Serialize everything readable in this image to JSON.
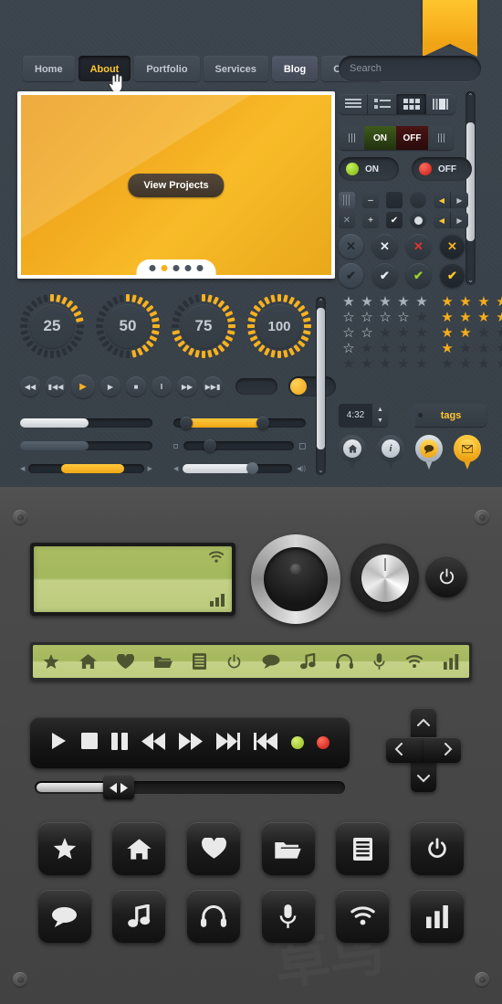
{
  "nav": {
    "items": [
      {
        "label": "Home",
        "state": "normal"
      },
      {
        "label": "About",
        "state": "active-dark"
      },
      {
        "label": "Portfolio",
        "state": "normal"
      },
      {
        "label": "Services",
        "state": "normal"
      },
      {
        "label": "Blog",
        "state": "active-blue"
      },
      {
        "label": "Contact",
        "state": "normal"
      }
    ]
  },
  "search": {
    "placeholder": "Search",
    "value": "",
    "icon": "search-icon"
  },
  "hero": {
    "button_label": "View Projects",
    "dots": 5,
    "active_dot": 2
  },
  "dials": [
    {
      "value": "25",
      "percent": 25
    },
    {
      "value": "50",
      "percent": 50
    },
    {
      "value": "75",
      "percent": 75
    },
    {
      "value": "100",
      "percent": 100
    }
  ],
  "transport_top": {
    "buttons": [
      "rewind-icon",
      "skip-back-icon",
      "play-icon",
      "play-alt-icon",
      "stop-icon",
      "pause-icon",
      "fast-forward-icon",
      "skip-forward-icon"
    ],
    "glyphs": [
      "◀◀",
      "▮◀◀",
      "▶",
      "▶",
      "■",
      "‖",
      "▶▶",
      "▶▶▮"
    ]
  },
  "sliders": {
    "left": [
      {
        "name": "white-slider",
        "fill": "white",
        "percent": 52
      },
      {
        "name": "steel-slider",
        "fill": "steel",
        "percent": 52
      },
      {
        "name": "gold-slider",
        "fill": "gold",
        "percent": 55
      }
    ],
    "right": [
      {
        "name": "range-slider",
        "percent": 60
      },
      {
        "name": "dot-slider",
        "percent": 18
      },
      {
        "name": "volume-slider",
        "percent": 62
      }
    ]
  },
  "viewmodes": {
    "options": [
      "list-view-icon",
      "detail-list-view-icon",
      "grid-view-icon",
      "column-view-icon"
    ],
    "active_index": 2
  },
  "onoff_bar": {
    "on_label": "ON",
    "off_label": "OFF"
  },
  "onoff_pills": [
    {
      "label": "ON",
      "led": "green"
    },
    {
      "label": "OFF",
      "led": "red"
    }
  ],
  "checkrow_1": [
    "checkbox-lined",
    "checkbox-minus",
    "checkbox-filled",
    "radio-empty",
    "stepper-left-right"
  ],
  "checkrow_2": [
    "checkbox-x",
    "checkbox-plus",
    "checkbox-check",
    "radio-selected",
    "stepper-left-right"
  ],
  "glyphs": {
    "minus": "–",
    "plus": "+",
    "check": "✔",
    "cross": "✕",
    "left": "◀",
    "right": "▶",
    "up": "▲",
    "down": "▼",
    "chev_up": "⌃",
    "chev_down": "⌄",
    "star_solid": "★",
    "star_hollow": "☆",
    "search": "⌕",
    "power": "⏻",
    "home": "⌂",
    "info": "i",
    "chat": "●",
    "mail": "✉"
  },
  "round_buttons": {
    "row_x": [
      "x-dark",
      "x-white",
      "x-red",
      "x-gold"
    ],
    "row_check": [
      "check-dark",
      "check-white",
      "check-green",
      "check-gold"
    ]
  },
  "stars": {
    "rows": [
      {
        "left_filled": 5,
        "left_style": "solid-grey",
        "right_filled": 5
      },
      {
        "left_filled": 4,
        "left_style": "hollow-grey",
        "right_filled": 4
      },
      {
        "left_filled": 2,
        "left_style": "hollow-grey",
        "right_filled": 2
      },
      {
        "left_filled": 1,
        "left_style": "hollow-grey",
        "right_filled": 1
      },
      {
        "left_filled": 0,
        "left_style": "dark",
        "right_filled": 0
      }
    ],
    "total": 5
  },
  "spinner": {
    "value": "4:32"
  },
  "tag": {
    "label": "tags"
  },
  "pins": [
    {
      "name": "pin-home",
      "icon": "home-icon",
      "style": "grey"
    },
    {
      "name": "pin-info",
      "icon": "info-icon",
      "style": "grey"
    },
    {
      "name": "pin-chat",
      "icon": "chat-icon",
      "style": "mix"
    },
    {
      "name": "pin-mail",
      "icon": "mail-icon",
      "style": "gold"
    }
  ],
  "lcd": {
    "wifi_icon": "wifi-icon",
    "signal_icon": "signal-bars-icon"
  },
  "green_toolbar": {
    "icons": [
      "star-icon",
      "home-icon",
      "heart-icon",
      "folder-icon",
      "list-icon",
      "power-icon",
      "chat-icon",
      "music-icon",
      "headphones-icon",
      "mic-icon",
      "wifi-icon",
      "signal-bars-icon"
    ]
  },
  "transport_bottom": {
    "buttons": [
      "play-icon",
      "stop-icon",
      "pause-icon",
      "rewind-icon",
      "fast-forward-icon",
      "next-track-icon",
      "prev-track-icon"
    ],
    "glyphs": [
      "▶",
      "■",
      "‖",
      "◀◀",
      "▶▶",
      "▶▶|",
      "|◀◀"
    ],
    "leds": [
      "led-green",
      "led-red"
    ]
  },
  "bottom_slider": {
    "percent": 22,
    "handle": "left-right-handle"
  },
  "dpad": {
    "up": "⌃",
    "down": "⌄",
    "left": "‹",
    "right": "›"
  },
  "icon_buttons": [
    {
      "name": "star-button",
      "icon": "star-icon"
    },
    {
      "name": "home-button",
      "icon": "home-icon"
    },
    {
      "name": "heart-button",
      "icon": "heart-icon"
    },
    {
      "name": "folder-button",
      "icon": "folder-icon"
    },
    {
      "name": "list-button",
      "icon": "list-icon"
    },
    {
      "name": "power-button",
      "icon": "power-icon"
    },
    {
      "name": "chat-button",
      "icon": "chat-icon"
    },
    {
      "name": "music-button",
      "icon": "music-icon"
    },
    {
      "name": "headphones-button",
      "icon": "headphones-icon"
    },
    {
      "name": "mic-button",
      "icon": "mic-icon"
    },
    {
      "name": "wifi-button",
      "icon": "wifi-icon"
    },
    {
      "name": "signal-button",
      "icon": "signal-bars-icon"
    }
  ],
  "colors": {
    "accent_gold": "#f7b11f",
    "top_panel": "#39414a",
    "bottom_panel": "#474747",
    "lcd_green": "#abbd62",
    "led_green": "#8eb725",
    "led_red": "#c5170f"
  }
}
